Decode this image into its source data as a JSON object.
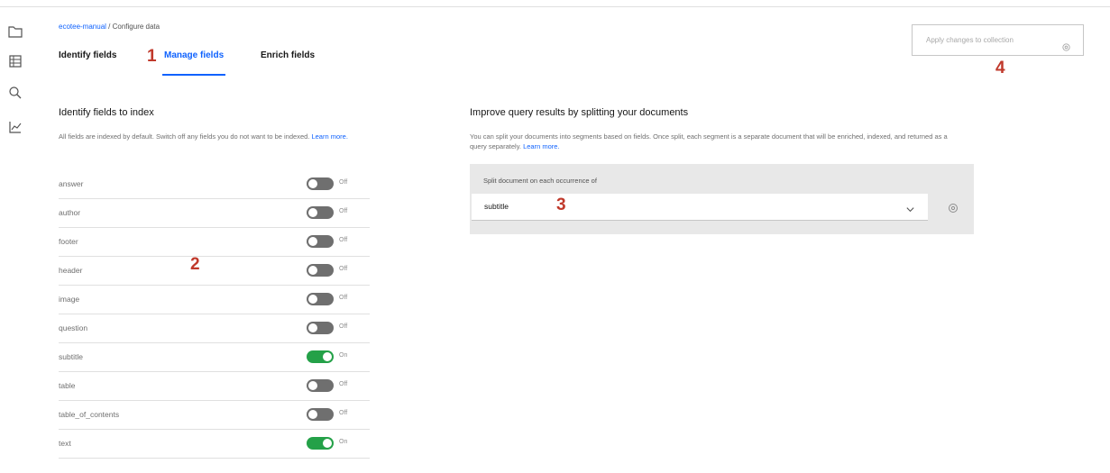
{
  "rail": {
    "icons": [
      "folder-icon",
      "data-table-icon",
      "search-icon",
      "chart-icon"
    ]
  },
  "breadcrumb": {
    "project": "ecotee-manual",
    "separator": "/",
    "page": "Configure data"
  },
  "tabs": [
    {
      "label": "Identify fields",
      "active": false
    },
    {
      "label": "Manage fields",
      "active": true
    },
    {
      "label": "Enrich fields",
      "active": false
    }
  ],
  "apply_button": {
    "label": "Apply changes to collection",
    "icon": "gear-icon"
  },
  "index_panel": {
    "title": "Identify fields to index",
    "description": "All fields are indexed by default. Switch off any fields you do not want to be indexed.",
    "learn_more": "Learn more.",
    "fields": [
      {
        "name": "answer",
        "state": "Off",
        "on": false
      },
      {
        "name": "author",
        "state": "Off",
        "on": false
      },
      {
        "name": "footer",
        "state": "Off",
        "on": false
      },
      {
        "name": "header",
        "state": "Off",
        "on": false
      },
      {
        "name": "image",
        "state": "Off",
        "on": false
      },
      {
        "name": "question",
        "state": "Off",
        "on": false
      },
      {
        "name": "subtitle",
        "state": "On",
        "on": true
      },
      {
        "name": "table",
        "state": "Off",
        "on": false
      },
      {
        "name": "table_of_contents",
        "state": "Off",
        "on": false
      },
      {
        "name": "text",
        "state": "On",
        "on": true
      }
    ]
  },
  "split_panel": {
    "title": "Improve query results by splitting your documents",
    "description": "You can split your documents into segments based on fields. Once split, each segment is a separate document that will be enriched, indexed, and returned as a query separately.",
    "learn_more": "Learn more.",
    "select_label": "Split document on each occurrence of",
    "select_value": "subtitle",
    "chevron_icon": "chevron-down-icon",
    "settings_icon": "settings-icon"
  },
  "annotations": [
    "1",
    "2",
    "3",
    "4"
  ],
  "colors": {
    "accent": "#0f62fe",
    "toggle_on": "#24a148",
    "toggle_off": "#6f6f6f",
    "annotation": "#c0392b"
  }
}
